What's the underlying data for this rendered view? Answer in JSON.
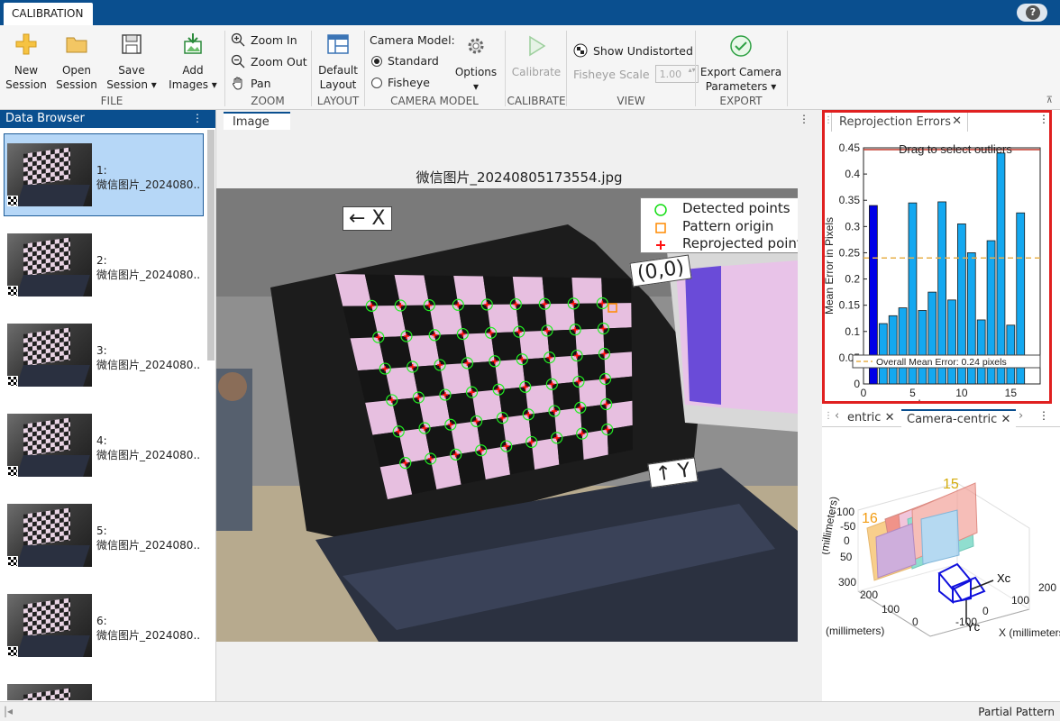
{
  "app": {
    "tab": "CALIBRATION",
    "help_icon": "question-icon"
  },
  "ribbon": {
    "file": {
      "label": "FILE",
      "new_session": "New\nSession",
      "new_session_l1": "New",
      "new_session_l2": "Session",
      "open_session_l1": "Open",
      "open_session_l2": "Session",
      "save_session_l1": "Save",
      "save_session_l2": "Session ▾",
      "add_images_l1": "Add",
      "add_images_l2": "Images ▾"
    },
    "zoom": {
      "label": "ZOOM",
      "zoom_in": "Zoom In",
      "zoom_out": "Zoom Out",
      "pan": "Pan"
    },
    "layout": {
      "label": "LAYOUT",
      "default_l1": "Default",
      "default_l2": "Layout"
    },
    "camera_model": {
      "label": "CAMERA MODEL",
      "title": "Camera Model:",
      "standard": "Standard",
      "fisheye": "Fisheye",
      "selected": "Standard",
      "options": "Options"
    },
    "calibrate": {
      "label": "CALIBRATE",
      "button": "Calibrate"
    },
    "view": {
      "label": "VIEW",
      "show_undistorted": "Show Undistorted",
      "fisheye_scale_label": "Fisheye Scale",
      "fisheye_scale_value": "1.00"
    },
    "export": {
      "label": "EXPORT",
      "l1": "Export Camera",
      "l2": "Parameters ▾"
    }
  },
  "data_browser": {
    "title": "Data Browser",
    "items": [
      {
        "index": "1:",
        "name": "微信图片_2024080...",
        "selected": true
      },
      {
        "index": "2:",
        "name": "微信图片_2024080...",
        "selected": false
      },
      {
        "index": "3:",
        "name": "微信图片_2024080...",
        "selected": false
      },
      {
        "index": "4:",
        "name": "微信图片_2024080...",
        "selected": false
      },
      {
        "index": "5:",
        "name": "微信图片_2024080...",
        "selected": false
      },
      {
        "index": "6:",
        "name": "微信图片_2024080...",
        "selected": false
      }
    ]
  },
  "image_panel": {
    "tab": "Image",
    "title": "微信图片_20240805173554.jpg",
    "legend": {
      "detected": "Detected points",
      "origin": "Pattern origin",
      "reprojected": "Reprojected points"
    },
    "labels": {
      "x_axis": "← X",
      "origin": "(0,0)",
      "y_axis": "↑ Y"
    }
  },
  "reprojection": {
    "tab": "Reprojection Errors",
    "hint": "Drag to select outliers",
    "overall": "Overall Mean Error: 0.24 pixels",
    "ylabel": "Mean Error in Pixels",
    "xlabel": "Images"
  },
  "camera_centric": {
    "tab_prev": "entric",
    "tab_active": "Camera-centric",
    "ylabel": "(millimeters)",
    "xlabel": "X (millimeters)",
    "xlabel_left": "(millimeters)",
    "num_16": "16",
    "num_15": "15",
    "axis_xc": "Xc",
    "axis_yc": "Yc",
    "ticks_y": [
      "-100",
      "-50",
      "0",
      "50"
    ],
    "ticks_z": [
      "300",
      "200",
      "100",
      "0"
    ],
    "ticks_x": [
      "-100",
      "0",
      "100",
      "200"
    ]
  },
  "chart_data": {
    "type": "bar",
    "title": "",
    "xlabel": "Images",
    "ylabel": "Mean Error in Pixels",
    "categories": [
      1,
      2,
      3,
      4,
      5,
      6,
      7,
      8,
      9,
      10,
      11,
      12,
      13,
      14,
      15,
      16,
      17
    ],
    "values": [
      0.34,
      0.115,
      0.13,
      0.145,
      0.345,
      0.14,
      0.175,
      0.347,
      0.16,
      0.305,
      0.25,
      0.122,
      0.273,
      0.44,
      0.112,
      0.326,
      0
    ],
    "highlighted_index": 0,
    "overall_mean": 0.24,
    "ylim": [
      0,
      0.45
    ],
    "yticks": [
      "0",
      "0.05",
      "0.1",
      "0.15",
      "0.2",
      "0.25",
      "0.3",
      "0.35",
      "0.4",
      "0.45"
    ],
    "xticks": [
      "0",
      "5",
      "10",
      "15"
    ],
    "legend": "Overall Mean Error: 0.24 pixels",
    "legend_position": "bottom"
  },
  "status": {
    "text": "Partial Pattern"
  },
  "colors": {
    "accent": "#0a4f8f",
    "bar": "#14a8f0",
    "bar_selected": "#0000e6",
    "mean_line": "#e8b04a",
    "highlight_frame": "#e02020"
  }
}
